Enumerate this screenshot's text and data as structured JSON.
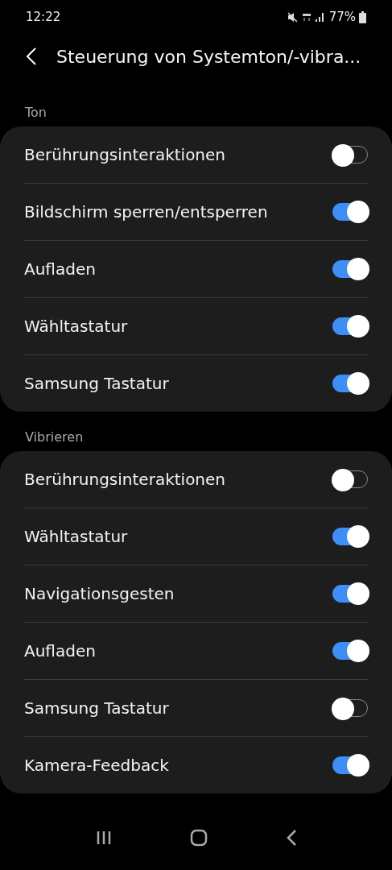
{
  "status_bar": {
    "time": "12:22",
    "battery": "77%"
  },
  "header": {
    "title": "Steuerung von Systemton/-vibra..."
  },
  "sections": [
    {
      "label": "Ton",
      "items": [
        {
          "label": "Berührungsinteraktionen",
          "on": false
        },
        {
          "label": "Bildschirm sperren/entsperren",
          "on": true
        },
        {
          "label": "Aufladen",
          "on": true
        },
        {
          "label": "Wähltastatur",
          "on": true
        },
        {
          "label": "Samsung Tastatur",
          "on": true
        }
      ]
    },
    {
      "label": "Vibrieren",
      "items": [
        {
          "label": "Berührungsinteraktionen",
          "on": false
        },
        {
          "label": "Wähltastatur",
          "on": true
        },
        {
          "label": "Navigationsgesten",
          "on": true
        },
        {
          "label": "Aufladen",
          "on": true
        },
        {
          "label": "Samsung Tastatur",
          "on": false
        },
        {
          "label": "Kamera-Feedback",
          "on": true
        }
      ]
    }
  ]
}
